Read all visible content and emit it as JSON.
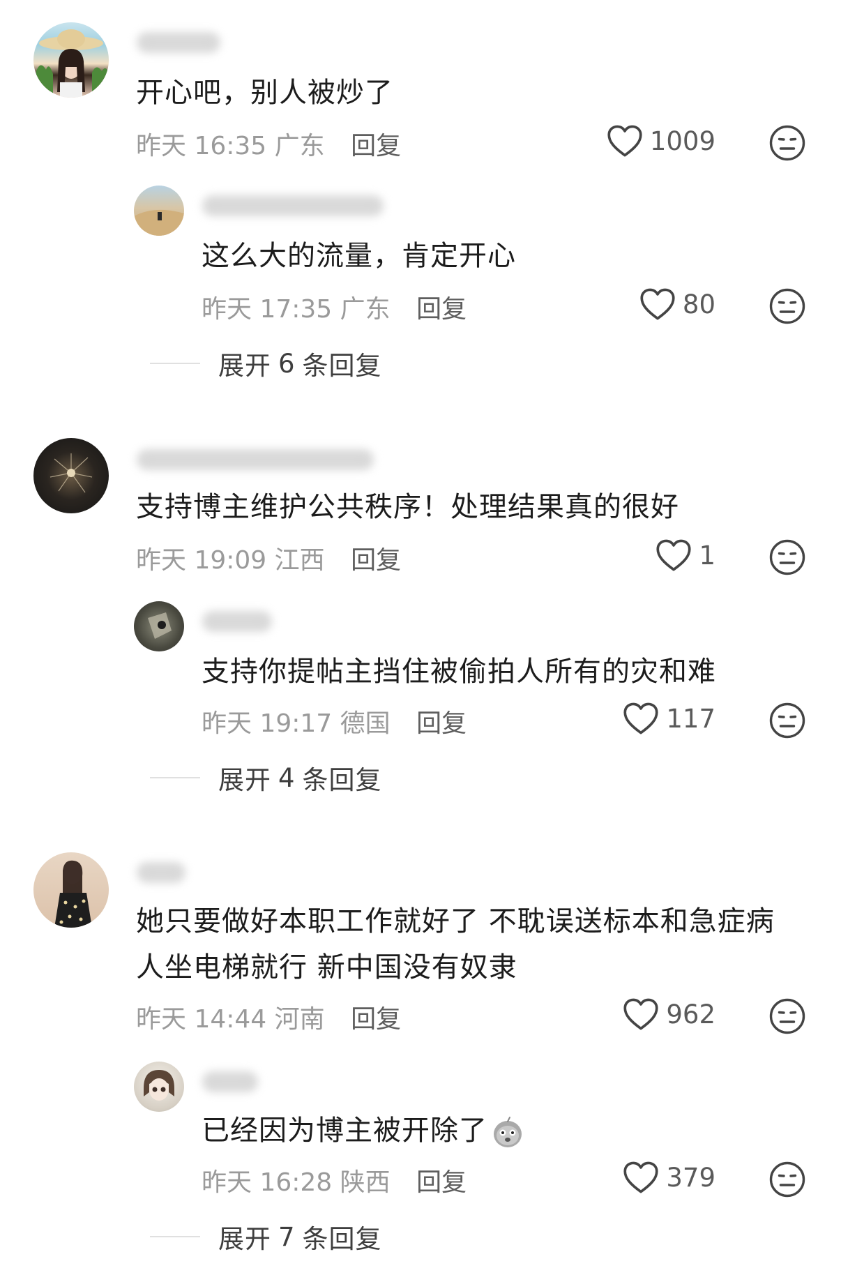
{
  "comments": [
    {
      "content": "开心吧，别人被炒了",
      "time": "昨天 16:35",
      "location": "广东",
      "reply": "回复",
      "likes": "1009",
      "replies": [
        {
          "content": "这么大的流量，肯定开心",
          "time": "昨天 17:35",
          "location": "广东",
          "reply": "回复",
          "likes": "80"
        }
      ],
      "expand": {
        "prefix": "展开",
        "count": "6",
        "suffix": "条回复"
      }
    },
    {
      "content": "支持博主维护公共秩序！处理结果真的很好",
      "time": "昨天 19:09",
      "location": "江西",
      "reply": "回复",
      "likes": "1",
      "replies": [
        {
          "content": "支持你提帖主挡住被偷拍人所有的灾和难",
          "time": "昨天 19:17",
          "location": "德国",
          "reply": "回复",
          "likes": "117"
        }
      ],
      "expand": {
        "prefix": "展开",
        "count": "4",
        "suffix": "条回复"
      }
    },
    {
      "content_line1": "她只要做好本职工作就好了 不耽误送标本和急症病",
      "content_line2": "人坐电梯就行 新中国没有奴隶",
      "time": "昨天 14:44",
      "location": "河南",
      "reply": "回复",
      "likes": "962",
      "replies": [
        {
          "content": "已经因为博主被开除了",
          "emoji": "doge-emoji",
          "time": "昨天 16:28",
          "location": "陕西",
          "reply": "回复",
          "likes": "379"
        }
      ],
      "expand": {
        "prefix": "展开",
        "count": "7",
        "suffix": "条回复"
      }
    }
  ],
  "icons": {
    "like": "heart-outline-icon",
    "dislike": "neutral-face-icon"
  },
  "colors": {
    "text": "#1c1c1c",
    "meta": "#9a9a9a",
    "reply": "#5e5e5e"
  }
}
